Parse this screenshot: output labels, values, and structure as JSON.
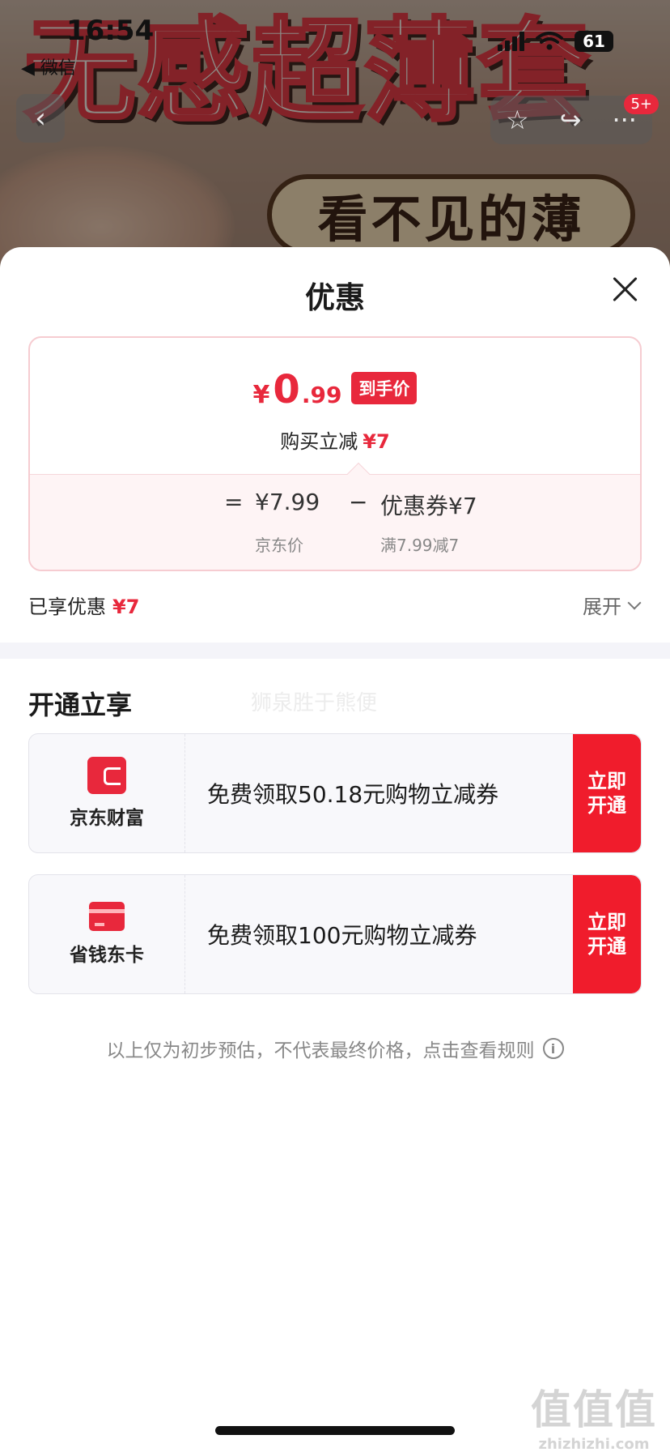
{
  "status_bar": {
    "time": "16:54",
    "back_app": "◀ 微信",
    "battery": "61"
  },
  "hero": {
    "title": "无感超薄套",
    "subtitle": "看不见的薄",
    "badge": "5+"
  },
  "sheet": {
    "title": "优惠",
    "price": {
      "currency": "¥",
      "integer": "0",
      "decimal": ".99",
      "tag": "到手价",
      "reduce_label": "购买立减",
      "reduce_value": "¥7",
      "equals": "=",
      "jd_price": "¥7.99",
      "minus": "−",
      "coupon": "优惠券¥7",
      "jd_price_label": "京东价",
      "coupon_rule": "满7.99减7"
    },
    "enjoyed": {
      "label": "已享优惠",
      "value": "¥7"
    },
    "expand_label": "展开",
    "section_title": "开通立享",
    "ghost_text": "狮泉胜于熊便",
    "promos": [
      {
        "name": "京东财富",
        "desc": "免费领取50.18元购物立减券",
        "cta_line1": "立即",
        "cta_line2": "开通",
        "icon": "wallet-icon"
      },
      {
        "name": "省钱东卡",
        "desc": "免费领取100元购物立减券",
        "cta_line1": "立即",
        "cta_line2": "开通",
        "icon": "card-icon"
      }
    ],
    "footnote": "以上仅为初步预估，不代表最终价格，点击查看规则",
    "info_glyph": "i"
  },
  "watermark": {
    "big": "值值值",
    "small": "zhizhizhi.com"
  },
  "colors": {
    "accent_red": "#e8283c",
    "cta_red": "#f01c2c",
    "text": "#1a1a1a"
  }
}
